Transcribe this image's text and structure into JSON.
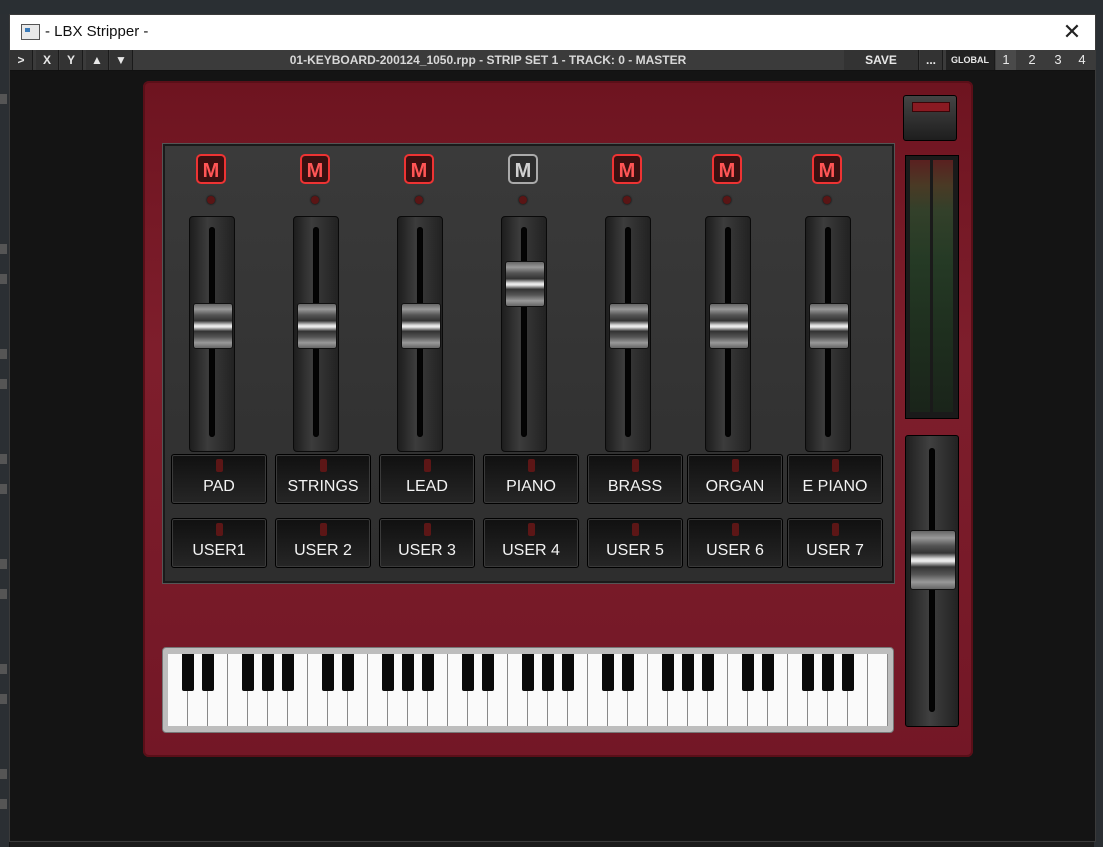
{
  "window": {
    "title": "- LBX Stripper -",
    "close_glyph": "✕"
  },
  "toolbar": {
    "left_buttons": [
      ">",
      "X",
      "Y",
      "▲",
      "▼"
    ],
    "title": "01-KEYBOARD-200124_1050.rpp - STRIP SET 1 - TRACK: 0 - MASTER",
    "save_label": "SAVE",
    "more_label": "...",
    "global_label": "GLOBAL",
    "pages": [
      "1",
      "2",
      "3",
      "4"
    ],
    "active_page": "1"
  },
  "mixer": {
    "channels": [
      {
        "mute_label": "M",
        "muted": true,
        "fader_level": 0.55,
        "preset_label": "PAD",
        "user_label": "USER1"
      },
      {
        "mute_label": "M",
        "muted": true,
        "fader_level": 0.55,
        "preset_label": "STRINGS",
        "user_label": "USER 2"
      },
      {
        "mute_label": "M",
        "muted": true,
        "fader_level": 0.55,
        "preset_label": "LEAD",
        "user_label": "USER 3"
      },
      {
        "mute_label": "M",
        "muted": false,
        "fader_level": 0.78,
        "preset_label": "PIANO",
        "user_label": "USER 4"
      },
      {
        "mute_label": "M",
        "muted": true,
        "fader_level": 0.55,
        "preset_label": "BRASS",
        "user_label": "USER 5"
      },
      {
        "mute_label": "M",
        "muted": true,
        "fader_level": 0.55,
        "preset_label": "ORGAN",
        "user_label": "USER 6"
      },
      {
        "mute_label": "M",
        "muted": true,
        "fader_level": 0.55,
        "preset_label": "E PIANO",
        "user_label": "USER 7"
      }
    ]
  },
  "master": {
    "fader_level": 0.6
  },
  "colors": {
    "panel_red": "#7e1e2c",
    "mute_active": "#ff5555"
  }
}
